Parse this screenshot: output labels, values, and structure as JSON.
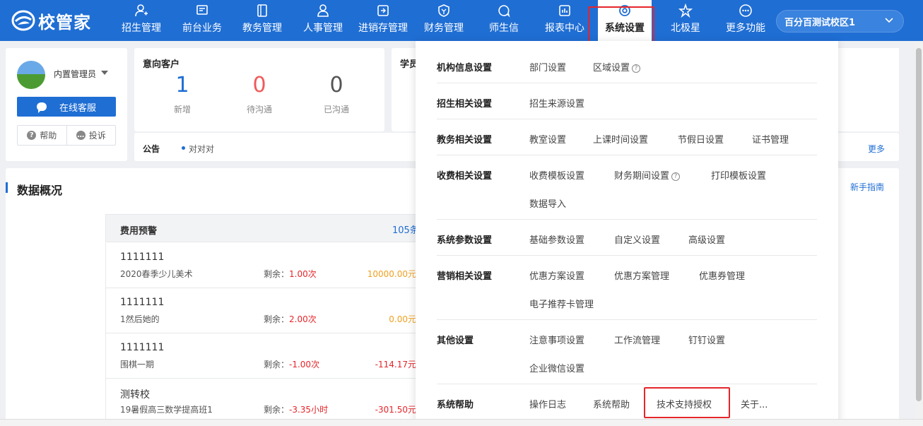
{
  "brand": {
    "name": "校管家"
  },
  "nav": {
    "items": [
      {
        "label": "招生管理",
        "icon": "person-add-icon"
      },
      {
        "label": "前台业务",
        "icon": "monitor-icon"
      },
      {
        "label": "教务管理",
        "icon": "book-icon"
      },
      {
        "label": "人事管理",
        "icon": "person-icon"
      },
      {
        "label": "进销存管理",
        "icon": "inventory-icon"
      },
      {
        "label": "财务管理",
        "icon": "finance-shield-icon"
      },
      {
        "label": "师生信",
        "icon": "chat-circle-icon"
      },
      {
        "label": "报表中心",
        "icon": "chart-icon"
      },
      {
        "label": "系统设置",
        "icon": "settings-icon"
      },
      {
        "label": "北极星",
        "icon": "star-icon"
      },
      {
        "label": "更多功能",
        "icon": "more-icon"
      }
    ],
    "active_index": 8,
    "school": "百分百测试校区1"
  },
  "user": {
    "name": "内置管理员",
    "online_service": "在线客服",
    "help": "帮助",
    "complaint": "投诉"
  },
  "intent": {
    "title": "意向客户",
    "stats": [
      {
        "value": "1",
        "label": "新增",
        "color": "#1f6ed4"
      },
      {
        "value": "0",
        "label": "待沟通",
        "color": "#f05a5a"
      },
      {
        "value": "0",
        "label": "已沟通",
        "color": "#555555"
      }
    ]
  },
  "students_partial_title": "学员",
  "notice": {
    "label": "公告",
    "text": "对对对",
    "more": "更多"
  },
  "overview": {
    "title": "数据概况",
    "guide": "新手指南"
  },
  "fee_warning": {
    "title": "费用预警",
    "count": "105条",
    "remain_label": "剩余：",
    "rows": [
      {
        "name": "1111111",
        "class": "2020春季少儿美术",
        "remain": "1.00次",
        "amount": "10000.00元",
        "amount_color": "#f0a020"
      },
      {
        "name": "1111111",
        "class": "1然后她的",
        "remain": "2.00次",
        "amount": "0.00元",
        "amount_color": "#f0a020"
      },
      {
        "name": "1111111",
        "class": "围棋一期",
        "remain": "-1.00次",
        "amount": "-114.17元",
        "amount_color": "#e5252a"
      },
      {
        "name": "测转校",
        "class": "19暑假高三数学提高班1",
        "remain": "-3.35小时",
        "amount": "-301.50元",
        "amount_color": "#e5252a"
      }
    ]
  },
  "settings_menu": {
    "rows": [
      {
        "category": "机构信息设置",
        "links": [
          "部门设置",
          "区域设置"
        ]
      },
      {
        "category": "招生相关设置",
        "links": [
          "招生来源设置"
        ]
      },
      {
        "category": "教务相关设置",
        "links": [
          "教室设置",
          "上课时间设置",
          "节假日设置",
          "证书管理"
        ]
      },
      {
        "category": "收费相关设置",
        "links": [
          "收费模板设置",
          "财务期间设置",
          "打印模板设置",
          "数据导入"
        ]
      },
      {
        "category": "系统参数设置",
        "links": [
          "基础参数设置",
          "自定义设置",
          "高级设置"
        ]
      },
      {
        "category": "营销相关设置",
        "links": [
          "优惠方案设置",
          "优惠方案管理",
          "优惠券管理",
          "电子推荐卡管理"
        ]
      },
      {
        "category": "其他设置",
        "links": [
          "注意事项设置",
          "工作流管理",
          "钉钉设置",
          "企业微信设置"
        ]
      },
      {
        "category": "系统帮助",
        "links": [
          "操作日志",
          "系统帮助",
          "技术支持授权",
          "关于..."
        ]
      }
    ]
  }
}
